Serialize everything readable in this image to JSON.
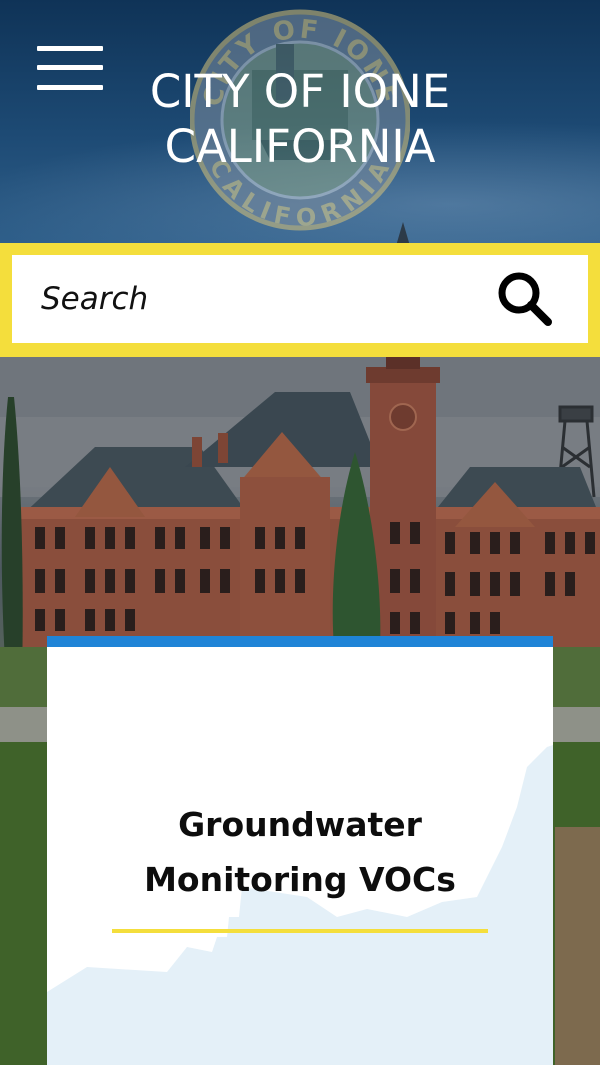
{
  "header": {
    "title_line1": "CITY OF IONE",
    "title_line2": "CALIFORNIA",
    "seal_text_top": "CITY OF IONE",
    "seal_text_bottom": "CALIFORNIA",
    "menu_icon": "hamburger-menu-icon"
  },
  "search": {
    "placeholder": "Search",
    "button_icon": "search-icon"
  },
  "hero": {
    "image": "historic-brick-building-photo"
  },
  "card": {
    "title_line1": "Groundwater",
    "title_line2": "Monitoring VOCs"
  },
  "colors": {
    "accent_yellow": "#f4de3c",
    "card_top_border": "#1f84d7",
    "header_blue": "#0f3357"
  }
}
